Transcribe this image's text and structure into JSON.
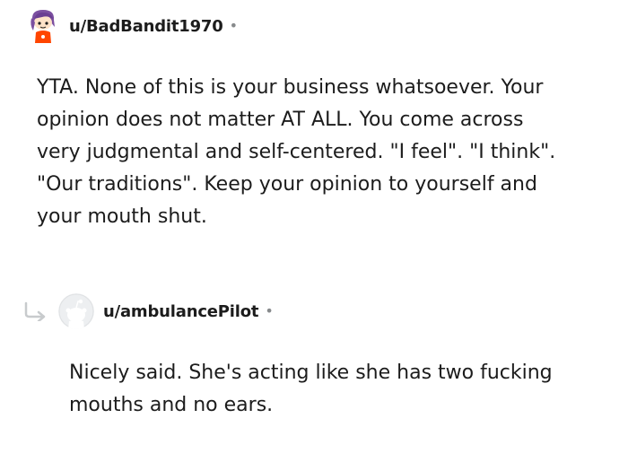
{
  "comment": {
    "username": "u/BadBandit1970",
    "separator": "•",
    "avatar_icon": "snoo-avatar-purple-hair-icon",
    "body_lines": [
      "YTA. None of this is your business whatsoever. Your",
      "opinion does not matter AT ALL. You come across",
      "very judgmental and self-centered. \"I feel\". \"I think\".",
      "\"Our traditions\". Keep your opinion to yourself and",
      "your mouth shut."
    ]
  },
  "reply": {
    "username": "u/ambulancePilot",
    "separator": "•",
    "avatar_icon": "default-snoo-avatar-icon",
    "reply_icon": "reply-arrow-icon",
    "body_lines": [
      "Nicely said. She's acting like she has two fucking",
      "mouths and no ears."
    ]
  },
  "colors": {
    "text": "#1c1c1c",
    "meta": "#878a8c",
    "avatar_bg": "#edeff1",
    "avatar_hair": "#7b4fa0",
    "avatar_shirt": "#ff4500"
  }
}
